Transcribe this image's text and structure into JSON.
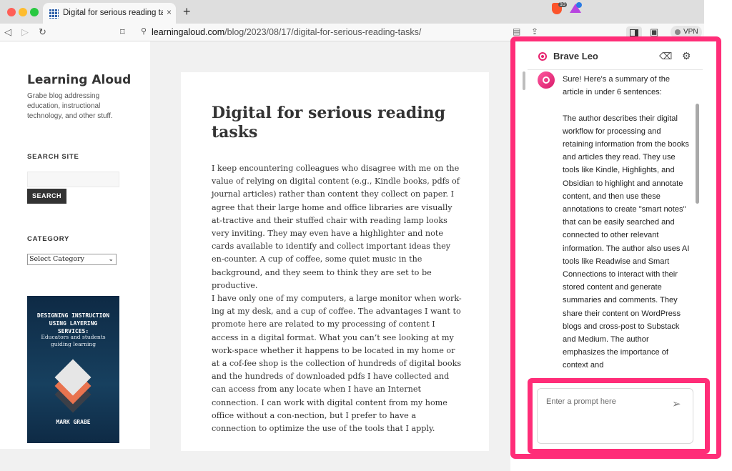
{
  "browser": {
    "tab_title": "Digital for serious reading tasks",
    "tab_close": "×",
    "new_tab": "+",
    "url_host": "learningaloud.com",
    "url_path": "/blog/2023/08/17/digital-for-serious-reading-tasks/",
    "rewards_badge": "10",
    "vpn_label": "VPN"
  },
  "blog": {
    "site_title": "Learning Aloud",
    "site_description": "Grabe blog addressing education, instructional technology, and other stuff.",
    "search_widget_title": "SEARCH SITE",
    "search_button": "SEARCH",
    "category_widget_title": "CATEGORY",
    "category_select": "Select Category",
    "book": {
      "title": "DESIGNING INSTRUCTION USING LAYERING SERVICES:",
      "subtitle": "Educators and students guiding learning",
      "author": "MARK GRABE"
    }
  },
  "article": {
    "title": "Digital for serious reading tasks",
    "paragraphs": [
      "I keep encountering colleagues who disagree with me on the value of relying on digital content (e.g., Kindle books, pdfs of journal articles) rather than content they collect on paper. I agree that their large home and office libraries are visually at-tractive and their stuffed chair with reading lamp looks very inviting. They may even have a highlighter and note cards available to identify and collect important ideas they en-counter. A cup of coffee, some quiet music in the background, and they seem to think they are set to be productive.",
      "I have only one of my computers, a large monitor when work-ing at my desk, and a cup of coffee. The advantages I want to promote here are related to my processing of content I access in a digital format. What you can’t see looking at my work-space whether it happens to be located in my home or at a cof-fee shop is the collection of hundreds of digital books and the hundreds of downloaded pdfs I have collected and can access from any locate when I have an Internet connection. I can work with digital content from my home office without a con-nection, but I prefer to have a connection to optimize the use of the tools that I apply."
    ]
  },
  "leo": {
    "title": "Brave Leo",
    "message": "Sure! Here's a summary of the article in under 6 sentences:\n\nThe author describes their digital workflow for processing and retaining information from the books and articles they read. They use tools like Kindle, Highlights, and Obsidian to highlight and annotate content, and then use these annotations to create \"smart notes\" that can be easily searched and connected to other relevant information. The author also uses AI tools like Readwise and Smart Connections to interact with their stored content and generate summaries and comments. They share their content on WordPress blogs and cross-post to Substack and Medium. The author emphasizes the importance of context and",
    "prompt_placeholder": "Enter a prompt here"
  },
  "colors": {
    "highlight": "#ff2d78",
    "leo_accent": "#e6206c"
  }
}
